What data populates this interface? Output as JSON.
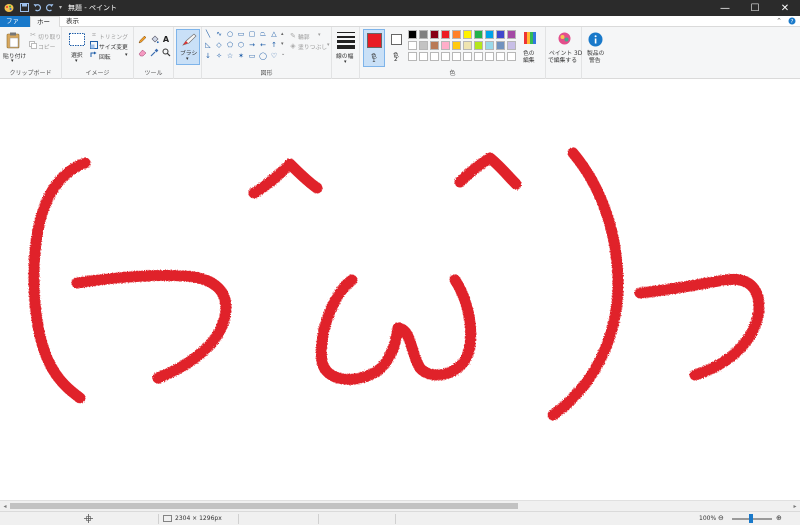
{
  "window": {
    "title": "無題 - ペイント",
    "controls": {
      "minimize": "—",
      "maximize": "☐",
      "close": "✕"
    }
  },
  "tabs": {
    "file": "ファイル",
    "home": "ホーム",
    "view": "表示"
  },
  "ribbon": {
    "clipboard": {
      "label": "クリップボード",
      "paste": "貼り付け",
      "cut": "切り取り",
      "copy": "コピー"
    },
    "image": {
      "label": "イメージ",
      "select": "選択",
      "crop": "トリミング",
      "resize": "サイズ変更",
      "rotate": "回転"
    },
    "tools": {
      "label": "ツール"
    },
    "brushes": {
      "label": "ブラシ"
    },
    "shapes": {
      "label": "図形",
      "outline": "輪郭",
      "fill": "塗りつぶし"
    },
    "size": {
      "label": "線の幅"
    },
    "colors": {
      "label": "色",
      "color1_label": "色",
      "color1_num": "1",
      "color2_label": "色",
      "color2_num": "2",
      "color1": "#e81c24",
      "color2": "#ffffff",
      "edit_colors": [
        "色の",
        "編集"
      ],
      "palette": [
        "#000000",
        "#7f7f7f",
        "#880015",
        "#ed1c24",
        "#ff7f27",
        "#fff200",
        "#22b14c",
        "#00a2e8",
        "#3f48cc",
        "#a349a4",
        "#ffffff",
        "#c3c3c3",
        "#b97a57",
        "#ffaec9",
        "#ffc90e",
        "#efe4b0",
        "#b5e61d",
        "#99d9ea",
        "#7092be",
        "#c8bfe7",
        "#ffffff",
        "#ffffff",
        "#ffffff",
        "#ffffff",
        "#ffffff",
        "#ffffff",
        "#ffffff",
        "#ffffff",
        "#ffffff",
        "#ffffff"
      ]
    },
    "paint3d": [
      "ペイント 3D",
      "で編集する"
    ],
    "product_alert": [
      "製品の",
      "警告"
    ]
  },
  "drawing": {
    "stroke_color": "#e0202a"
  },
  "status": {
    "canvas_size": "2304 × 1296px",
    "zoom": "100%"
  }
}
